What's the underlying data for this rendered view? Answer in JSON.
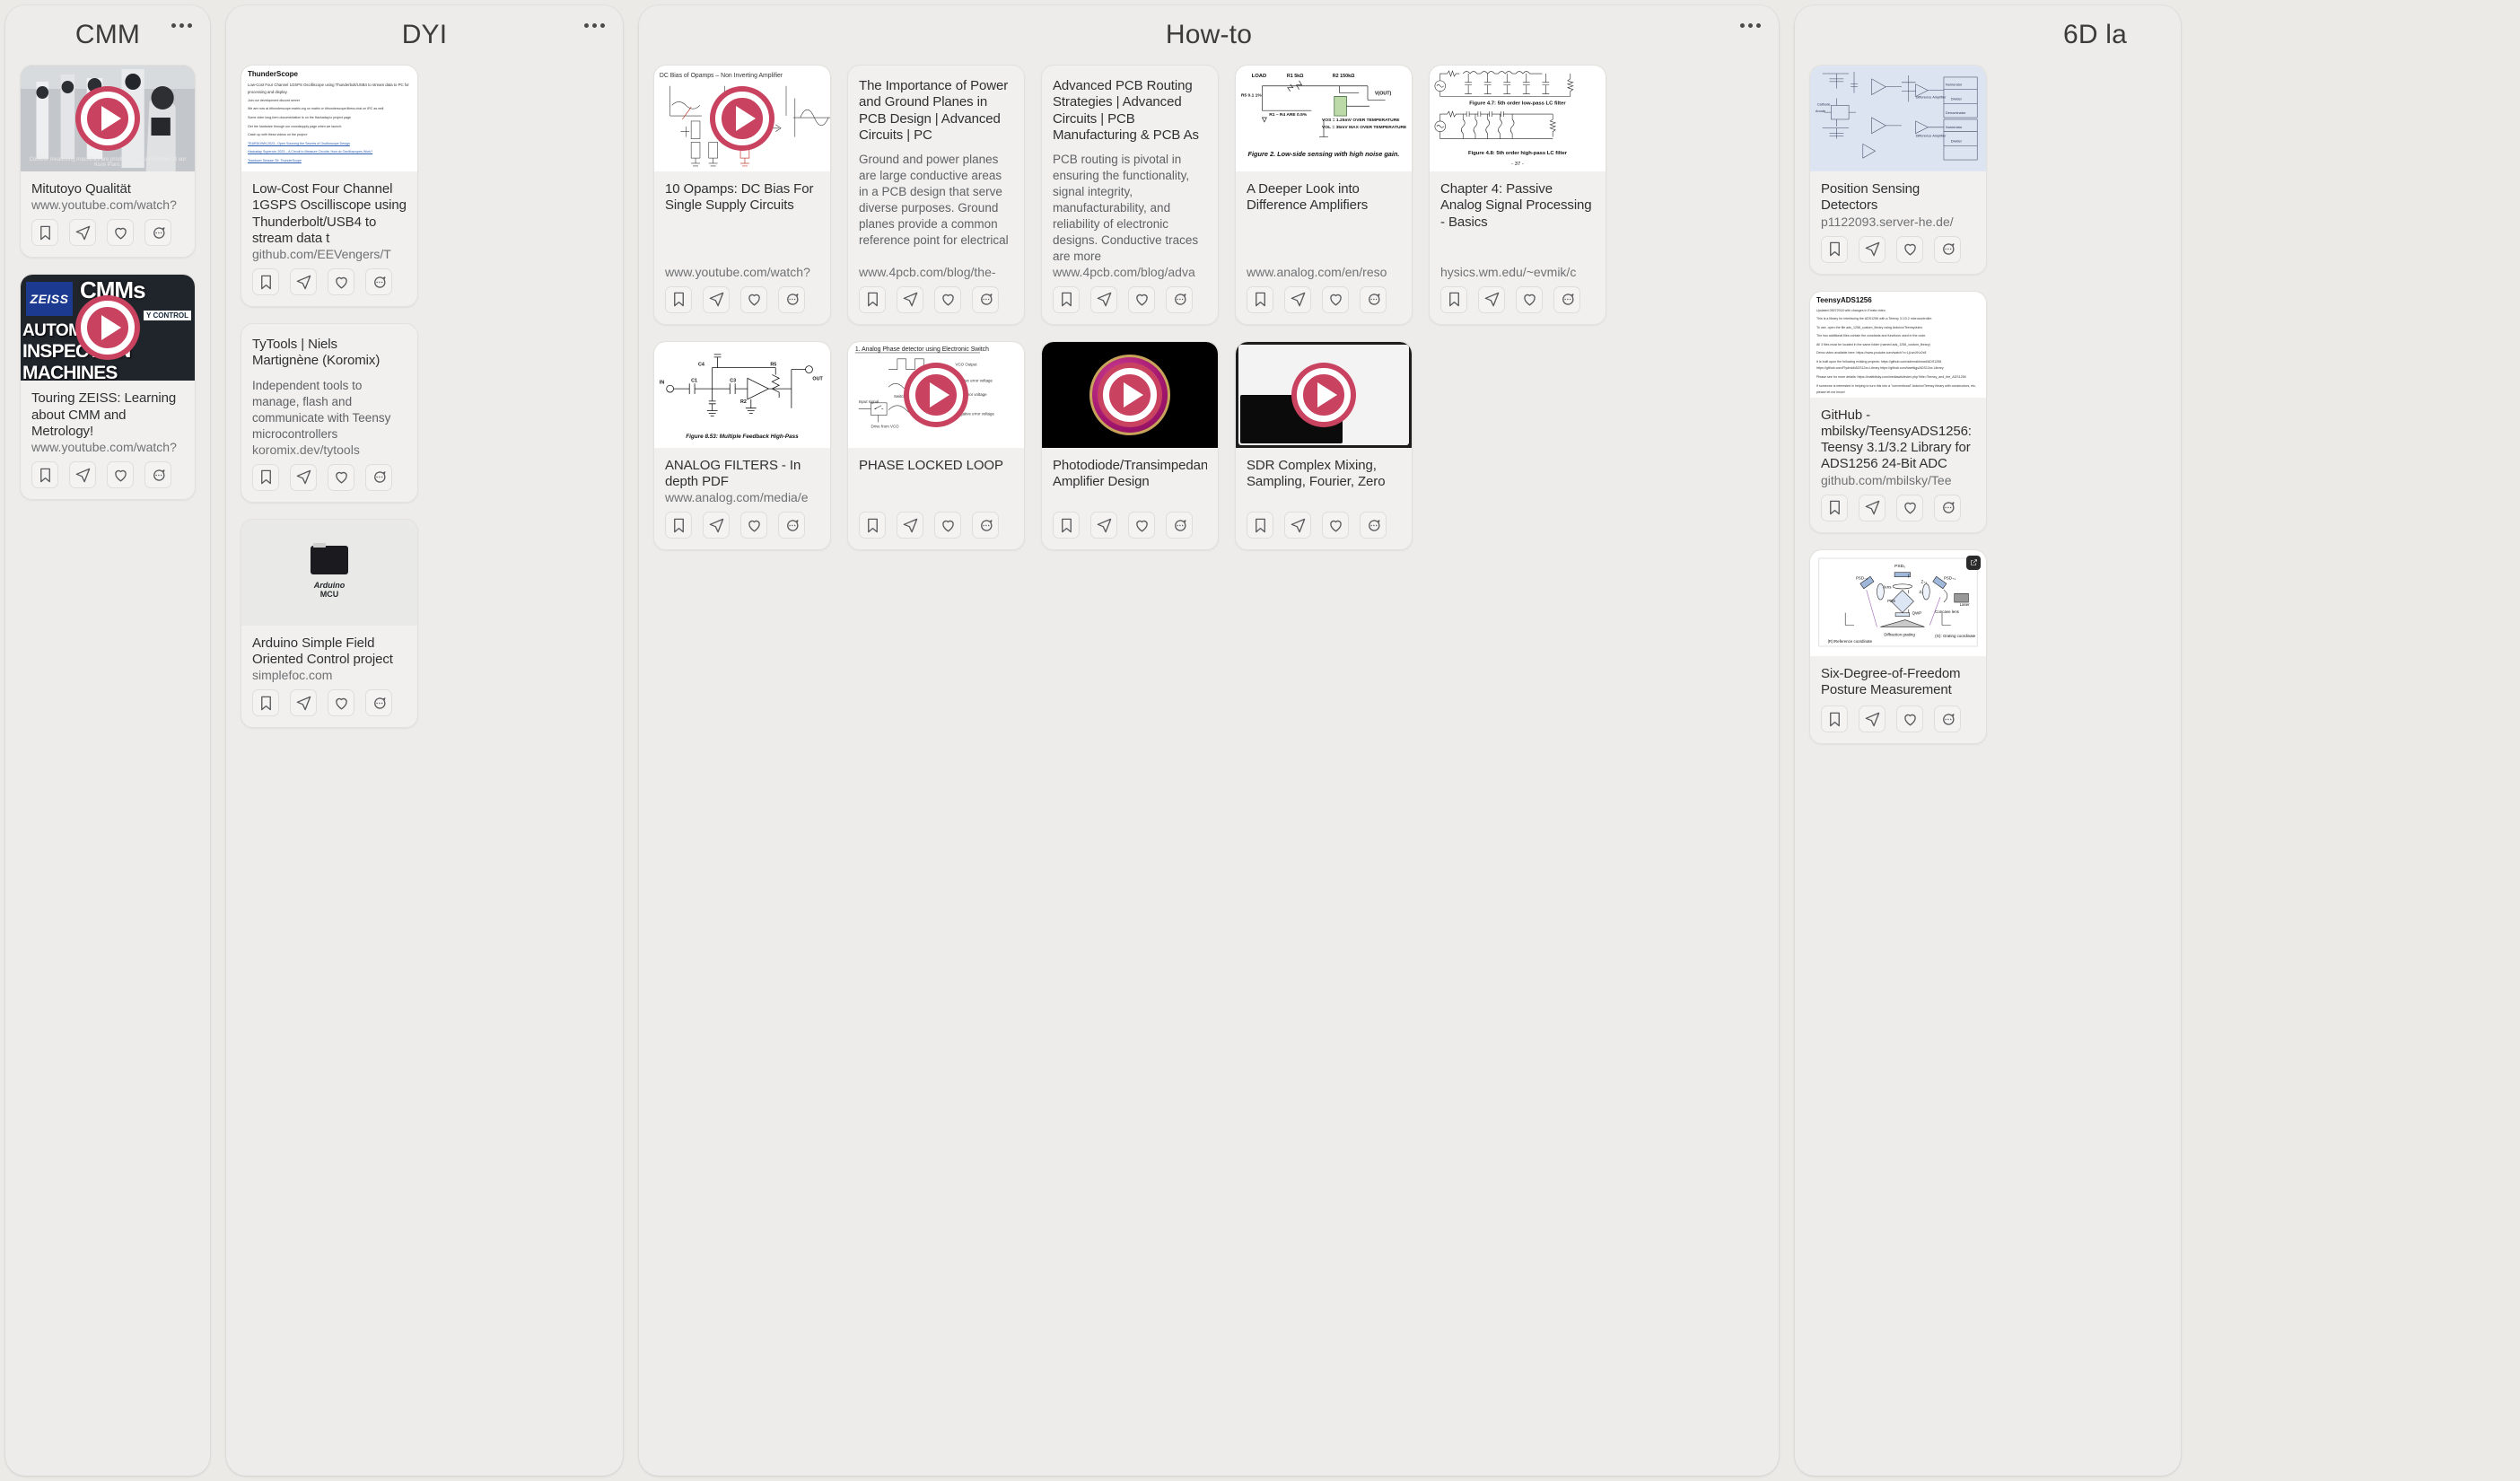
{
  "accent_color": "#c9425f",
  "board_background": "#eceae6",
  "column_background": "#eeecea",
  "card_background": "#f1f0ee",
  "action_labels": {
    "bookmark": "bookmark-icon",
    "send": "send-icon",
    "like": "heart-icon",
    "comment": "comment-icon"
  },
  "columns": [
    {
      "title": "CMM",
      "menu": "more-options",
      "cards": [
        {
          "title": "Mitutoyo Qualität",
          "desc": "",
          "url": "www.youtube.com/watch?",
          "thumb": "video-factory",
          "caption": "Contour measuring machines are produced and assembled at our Kure Plant.",
          "has_play": true
        },
        {
          "title": "Touring ZEISS: Learning about CMM and Metrology!",
          "desc": "",
          "url": "www.youtube.com/watch?",
          "thumb": "video-zeiss",
          "zeiss_brand": "ZEISS",
          "zeiss_cmms": "CMMs",
          "zeiss_qc": "Y CONTROL",
          "zeiss_auto": "AUTOMA",
          "zeiss_insp": "INSPECTION MACHINES",
          "has_play": true
        }
      ]
    },
    {
      "title": "DYI",
      "menu": "more-options",
      "cards": [
        {
          "title": "Low-Cost Four Channel 1GSPS Oscilliscope using Thunderbolt/USB4 to stream data t",
          "desc": "",
          "url": "github.com/EEVengers/T",
          "thumb": "web-thunderscope",
          "preview": {
            "heading": "ThunderScope",
            "lines": [
              "Low-Cost Four Channel 1GSPS Oscilliscope using Thunderbolt/USB4 to stream data to PC for processing and display.",
              "Join our development discord server",
              "We are now at #thunderscope:matrix.org on matrix or #thunderscope:libera.chat on IRC as well",
              "Some older long-form documentation is on the Hackaday.io project page",
              "Get the hardware through our crowdsupply page when we launch:",
              "Catch up with these videos on the project:",
              "TEARDOWN 2023 - Open Sourcing the Secrets of Oscilloscope Design",
              "Hackaday Supercon 2023 – A Circuit to Measure Circuits: How do Oscilloscopes Work?",
              "Teardown Session 39: ThunderScope"
            ]
          },
          "has_play": false
        },
        {
          "title": "TyTools | Niels Martignène (Koromix)",
          "desc": "Independent tools to manage, flash and communicate with Teensy microcontrollers",
          "url": "koromix.dev/tytools",
          "thumb": "none",
          "has_play": false
        },
        {
          "title": "Arduino Simple Field Oriented Control project",
          "desc": "",
          "url": "simplefoc.com",
          "thumb": "arduino",
          "arduino_label": "Arduino",
          "arduino_label2": "MCU",
          "has_play": false
        }
      ]
    },
    {
      "title": "How-to",
      "menu": "more-options",
      "cards": [
        {
          "title": "10 Opamps: DC Bias For Single Supply Circuits",
          "desc": "",
          "url": "www.youtube.com/watch?",
          "thumb": "opamp-bias",
          "thumb_caption": "DC Bias of Opamps – Non Inverting Amplifier",
          "has_play": true
        },
        {
          "title": "The Importance of Power and Ground Planes in PCB Design | Advanced Circuits | PC",
          "desc": "Ground and power planes are large conductive areas in a PCB design that serve diverse purposes. Ground planes provide a common reference point for electrical",
          "url": "www.4pcb.com/blog/the-",
          "thumb": "none",
          "has_play": false
        },
        {
          "title": "Advanced PCB Routing Strategies | Advanced Circuits | PCB Manufacturing & PCB As",
          "desc": "PCB routing is pivotal in ensuring the functionality, signal integrity, manufacturability, and reliability of electronic designs. Conductive traces are more",
          "url": "www.4pcb.com/blog/adva",
          "thumb": "none",
          "has_play": false
        },
        {
          "title": "A Deeper Look into Difference Amplifiers",
          "desc": "",
          "url": "www.analog.com/en/reso",
          "thumb": "diff-amp",
          "thumb_caption": "Figure 2. Low-side sensing with high noise gain.",
          "has_play": false
        },
        {
          "title": "Chapter 4: Passive Analog Signal Processing - Basics",
          "desc": "",
          "url": "hysics.wm.edu/~evmik/c",
          "thumb": "lc-filters",
          "thumb_caption": "Figure 4.7: 5th order low-pass LC filter",
          "thumb_caption2": "Figure 4.8: 5th order high-pass LC filter",
          "thumb_page": "- 37 -",
          "has_play": false
        },
        {
          "title": "ANALOG FILTERS - In depth PDF",
          "desc": "",
          "url": "www.analog.com/media/e",
          "thumb": "mfb-highpass",
          "thumb_caption": "Figure 8.53: Multiple Feedback High-Pass",
          "has_play": false
        },
        {
          "title": "PHASE LOCKED LOOP",
          "desc": "",
          "url": "",
          "thumb": "pll",
          "thumb_caption": "1. Analog Phase detector using Electronic Switch",
          "has_play": true
        },
        {
          "title": "Photodiode/Transimpedance Amplifier Design",
          "desc": "",
          "url": "",
          "thumb": "pcb-disc",
          "has_play": true
        },
        {
          "title": "SDR Complex Mixing, Sampling, Fourier, Zero",
          "desc": "",
          "url": "",
          "thumb": "sdr",
          "has_play": true
        }
      ]
    },
    {
      "title": "6D la",
      "menu": "more-options",
      "cards": [
        {
          "title": "Position Sensing Detectors",
          "desc": "",
          "url": "p1122093.server-he.de/",
          "thumb": "psd-circuit",
          "has_play": false
        },
        {
          "title": "GitHub - mbilsky/TeensyADS1256: Teensy 3.1/3.2 Library for ADS1256 24-Bit ADC",
          "desc": "",
          "url": "github.com/mbilsky/Tee",
          "thumb": "web-teensyads",
          "preview": {
            "heading": "TeensyADS1256",
            "lines": [
              "Updated 05072018 with changes in Errata video",
              "This is a library for interfacing the ADS1256 with a Teensy 3.1/3.2 microcontroller.",
              "To use, open the file ads_1256_custom_library using Arduino/Teensyduino",
              "The two additional files contain the constants and functions used in the code.",
              "All 3 files must be located in the same folder (named ads_1256_custom_library)",
              "Demo video available here: https://www.youtube.com/watch?v=LjLwvXKz2x8",
              "It is built upon the following existing projects: https://github.com/adienakhmad/ADS1256 https://github.com/Flydroid/ADS12xx-Library https://github.com/baettigp/ADS12xx-Library",
              "Please see for more details: https://mattbilsky.com/mediawiki/index.php?title=Teensy_and_the_ADS1256",
              "If someone is interested in helping to turn this into a \"conventional\" Arduino/Teensy library with constructors, etc, please let me know!"
            ]
          },
          "has_play": false
        },
        {
          "title": "Six-Degree-of-Freedom Posture Measurement",
          "desc": "",
          "url": "",
          "thumb": "sixdof",
          "labels": [
            "PSD0",
            "PSD-1",
            "PSD-1",
            "lens",
            "PBS",
            "QWP",
            "Laser",
            "Concave lens",
            "Diffraction grating",
            "(R):Reference coordinate",
            "(G): Grating coordinate"
          ],
          "has_play": false,
          "has_ext_badge": true
        }
      ]
    }
  ]
}
